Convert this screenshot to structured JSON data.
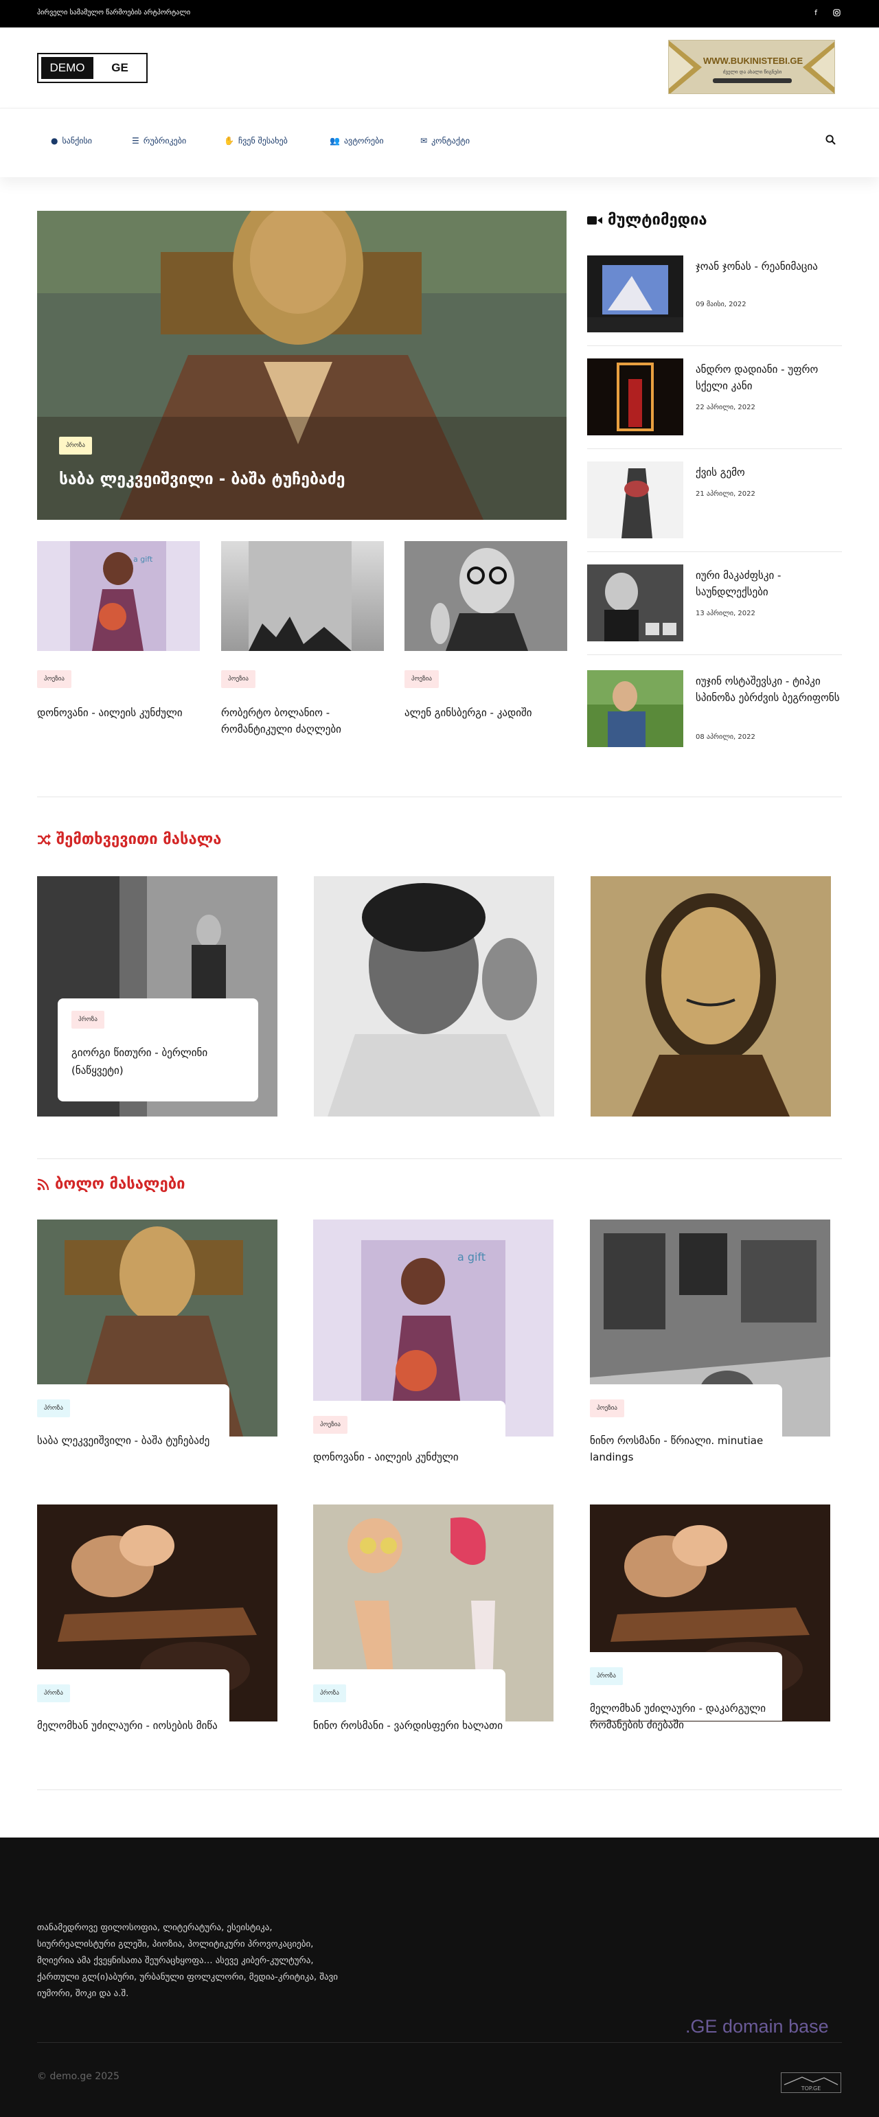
{
  "topbar": {
    "tagline": "პირველი სამამულო წარმოების არტპორტალი",
    "icons": [
      "facebook-icon",
      "instagram-icon"
    ]
  },
  "logo": {
    "part1": "DEMO",
    "part2": "GE"
  },
  "ad": {
    "title": "WWW.BUKINISTEBI.GE",
    "subtitle": "ძველი და ახალი წიგნები"
  },
  "nav": {
    "items": [
      {
        "label": "სანქისი",
        "icon": "user-secret-icon"
      },
      {
        "label": "რუბრიკები",
        "icon": "tasks-icon"
      },
      {
        "label": "ჩვენ შესახებ",
        "icon": "handshake-icon"
      },
      {
        "label": "ავტორები",
        "icon": "users-icon"
      },
      {
        "label": "კონტაქტი",
        "icon": "inbox-icon"
      }
    ],
    "search_icon": "search-icon"
  },
  "hero": {
    "category": "პროზა",
    "title": "საბა ლეკვეიშვილი - ბაშა ტუჩებაძე"
  },
  "featured": [
    {
      "category": "პოეზია",
      "title": "დონოვანი - აილეის კუნძული"
    },
    {
      "category": "პოეზია",
      "title": "რობერტო ბოლანიო - რომანტიკული ძაღლები"
    },
    {
      "category": "პოეზია",
      "title": "ალენ გინსბერგი - კადიში"
    }
  ],
  "multimedia": {
    "heading": "მულტიმედია",
    "items": [
      {
        "title": "ჯოან ჯონას - რეანიმაცია",
        "date": "09 მაისი, 2022"
      },
      {
        "title": "ანდრო დადიანი - უფრო სქელი კანი",
        "date": "22 აპრილი, 2022"
      },
      {
        "title": "ქვის გემო",
        "date": "21 აპრილი, 2022"
      },
      {
        "title": "იური მაკაძფსკი - საუნდლექსები",
        "date": "13 აპრილი, 2022"
      },
      {
        "title": "იუჯინ ოსტაშევსკი - ტიპკი სპინოზა ებრძვის ბეგრიფონს",
        "date": "08 აპრილი, 2022"
      }
    ]
  },
  "random": {
    "heading": "შემთხვევითი მასალა",
    "card": {
      "category": "პროზა",
      "title": "გიორგი წითური - ბერლინი (ნაწყვეტი)"
    }
  },
  "latest": {
    "heading": "ბოლო მასალები",
    "items": [
      {
        "category": "პროზა",
        "title": "საბა ლეკვეიშვილი - ბაშა ტუჩებაძე",
        "badge": "cyan"
      },
      {
        "category": "პოეზია",
        "title": "დონოვანი - აილეის კუნძული",
        "badge": "pink"
      },
      {
        "category": "პოეზია",
        "title": "ნინო როსმანი - წრიალი. minutiae landings",
        "badge": "pink"
      },
      {
        "category": "პროზა",
        "title": "მელომხან უძილაური - იოსების მიწა",
        "badge": "cyan"
      },
      {
        "category": "პროზა",
        "title": "ნინო როსმანი - ვარდისფერი ხალათი",
        "badge": "cyan"
      },
      {
        "category": "პროზა",
        "title": "მელომხან უძილაური - დაკარგული რომანების ძიებაში",
        "badge": "cyan"
      }
    ]
  },
  "footer": {
    "about": "თანამედროვე ფილოსოფია, ლიტერატურა, ესეისტიკა, სიურრეალისტური გლეში, პიოზია, პოლიტიკური პროვოკაციები, მღიერია ამა ქვეყნისათა შეურაცხყოფა… ასევე კიბერ-კულტურა, ქართული გლ(ი)აბური, ურბანული ფოლკლორი, მედია-კრიტიკა, შავი იუმორი, შოკი და ა.შ.",
    "domain": ".GE domain base",
    "copyright": "© demo.ge 2025",
    "top_badge": "TOP.GE"
  },
  "colors": {
    "accent": "#d32626",
    "nav": "#1a3a6a",
    "footer_bg": "#111111"
  }
}
